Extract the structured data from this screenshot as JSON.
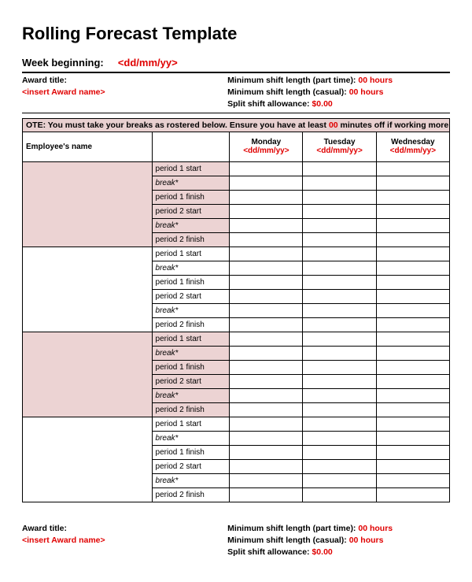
{
  "title": "Rolling Forecast Template",
  "week_label": "Week beginning:",
  "week_value": "<dd/mm/yy>",
  "meta": {
    "award_title_label": "Award title:",
    "award_title_value": "<insert Award name>",
    "min_pt_label": "Minimum shift length (part time): ",
    "min_pt_value": "00 hours",
    "min_casual_label": "Minimum shift length (casual): ",
    "min_casual_value": "00 hours",
    "split_label": "Split shift allowance: ",
    "split_value": "$0.00"
  },
  "note_prefix": "OTE: You must take your breaks as rostered below. Ensure you have at least ",
  "note_mins": "00",
  "note_suffix": " minutes off if working more th",
  "headers": {
    "employee": "Employee's name",
    "days": [
      {
        "name": "Monday",
        "date": "<dd/mm/yy>"
      },
      {
        "name": "Tuesday",
        "date": "<dd/mm/yy>"
      },
      {
        "name": "Wednesday",
        "date": "<dd/mm/yy>"
      }
    ]
  },
  "period_rows": [
    {
      "label": "period 1 start",
      "italic": false
    },
    {
      "label": "break*",
      "italic": true
    },
    {
      "label": "period 1 finish",
      "italic": false
    },
    {
      "label": "period 2 start",
      "italic": false
    },
    {
      "label": "break*",
      "italic": true
    },
    {
      "label": "period 2 finish",
      "italic": false
    }
  ],
  "footer": {
    "award_title_label": "Award title:",
    "award_title_value": "<insert Award name>",
    "min_pt_label": "Minimum shift length (part time): ",
    "min_pt_value": "00 hours",
    "min_casual_label": "Minimum shift length (casual): ",
    "min_casual_value": "00 hours",
    "split_label": "Split shift allowance: ",
    "split_value": "$0.00"
  }
}
